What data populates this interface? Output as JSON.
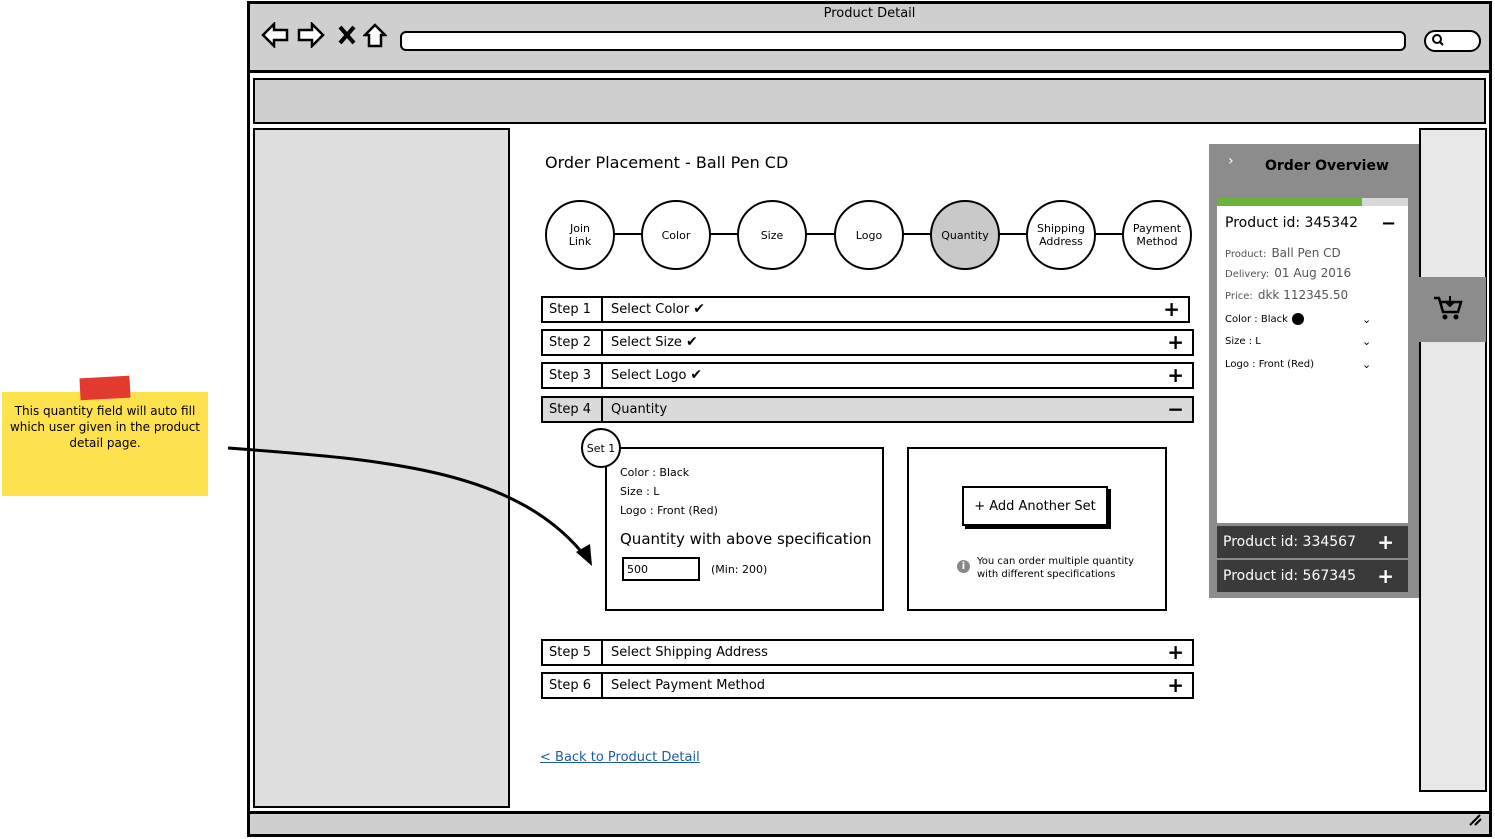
{
  "window": {
    "title": "Product Detail"
  },
  "sticky_note": {
    "text": "This quantity field will auto fill which user given in the product detail page."
  },
  "page": {
    "title": "Order Placement - Ball Pen CD"
  },
  "stepper": [
    {
      "line1": "Join",
      "line2": "Link"
    },
    {
      "line1": "Color",
      "line2": ""
    },
    {
      "line1": "Size",
      "line2": ""
    },
    {
      "line1": "Logo",
      "line2": ""
    },
    {
      "line1": "Quantity",
      "line2": ""
    },
    {
      "line1": "Shipping",
      "line2": "Address"
    },
    {
      "line1": "Payment",
      "line2": "Method"
    }
  ],
  "steps": [
    {
      "no": "Step 1",
      "label": "Select Color",
      "done": true,
      "toggle": "+"
    },
    {
      "no": "Step 2",
      "label": "Select Size",
      "done": true,
      "toggle": "+"
    },
    {
      "no": "Step 3",
      "label": "Select Logo",
      "done": true,
      "toggle": "+"
    },
    {
      "no": "Step 4",
      "label": "Quantity",
      "done": false,
      "toggle": "−"
    },
    {
      "no": "Step 5",
      "label": "Select Shipping Address",
      "done": false,
      "toggle": "+"
    },
    {
      "no": "Step 6",
      "label": "Select Payment Method",
      "done": false,
      "toggle": "+"
    }
  ],
  "set": {
    "badge": "Set 1",
    "color": "Color : Black",
    "size": "Size : L",
    "logo": "Logo : Front (Red)",
    "quantity_title": "Quantity with above specification",
    "quantity_value": "500",
    "min_label": "(Min: 200)"
  },
  "add_set": {
    "button": "+ Add Another Set",
    "info": "You can order multiple quantity with different specifications"
  },
  "back_link": "< Back to Product Detail",
  "overview": {
    "title": "Order Overview",
    "progress": 0.76,
    "active_product": {
      "id": "Product id: 345342",
      "product_label": "Product:",
      "product_value": "Ball Pen CD",
      "delivery_label": "Delivery:",
      "delivery_value": "01 Aug 2016",
      "price_label": "Price:",
      "price_value": "dkk 112345.50",
      "color": "Color : Black",
      "size": "Size : L",
      "logo": "Logo : Front (Red)"
    },
    "other_products": [
      "Product id: 334567",
      "Product id: 567345"
    ]
  }
}
